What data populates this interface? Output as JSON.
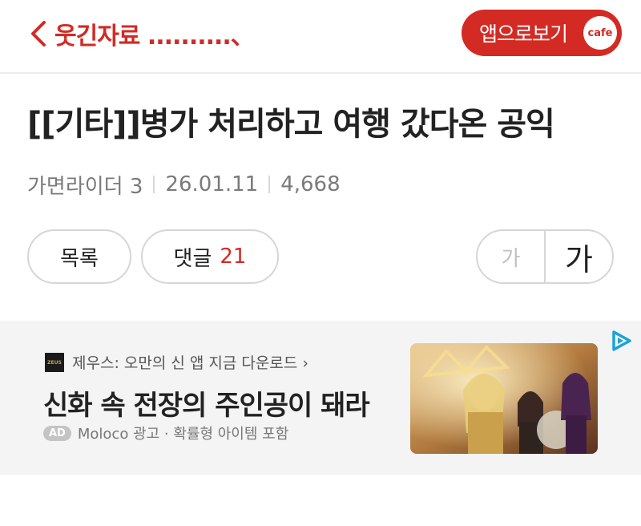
{
  "header": {
    "back_icon": "chevron-left-icon",
    "board_name": "웃긴자료 ..........、",
    "app_button_label": "앱으로보기",
    "cafe_badge": "cafe"
  },
  "post": {
    "title": "[[기타]]병가 처리하고 여행 갔다온 공익",
    "author": "가면라이더 3",
    "date": "26.01.11",
    "views": "4,668"
  },
  "actions": {
    "list_label": "목록",
    "comment_label": "댓글",
    "comment_count": "21",
    "font_small": "가",
    "font_large": "가"
  },
  "ad": {
    "logo_text": "ZEUS",
    "sponsor_line": "제우스: 오만의 신 앱 지금 다운로드 ›",
    "headline": "신화 속 전장의 주인공이 돼라",
    "badge": "AD",
    "footer_text": "Moloco 광고 · 확률형 아이템 포함",
    "choice_icon": "adchoices-icon"
  },
  "colors": {
    "accent": "#d32a24",
    "text": "#222222",
    "muted": "#7a7a7a",
    "border": "#d6d6d6",
    "ad_background": "#f4f4f4"
  }
}
